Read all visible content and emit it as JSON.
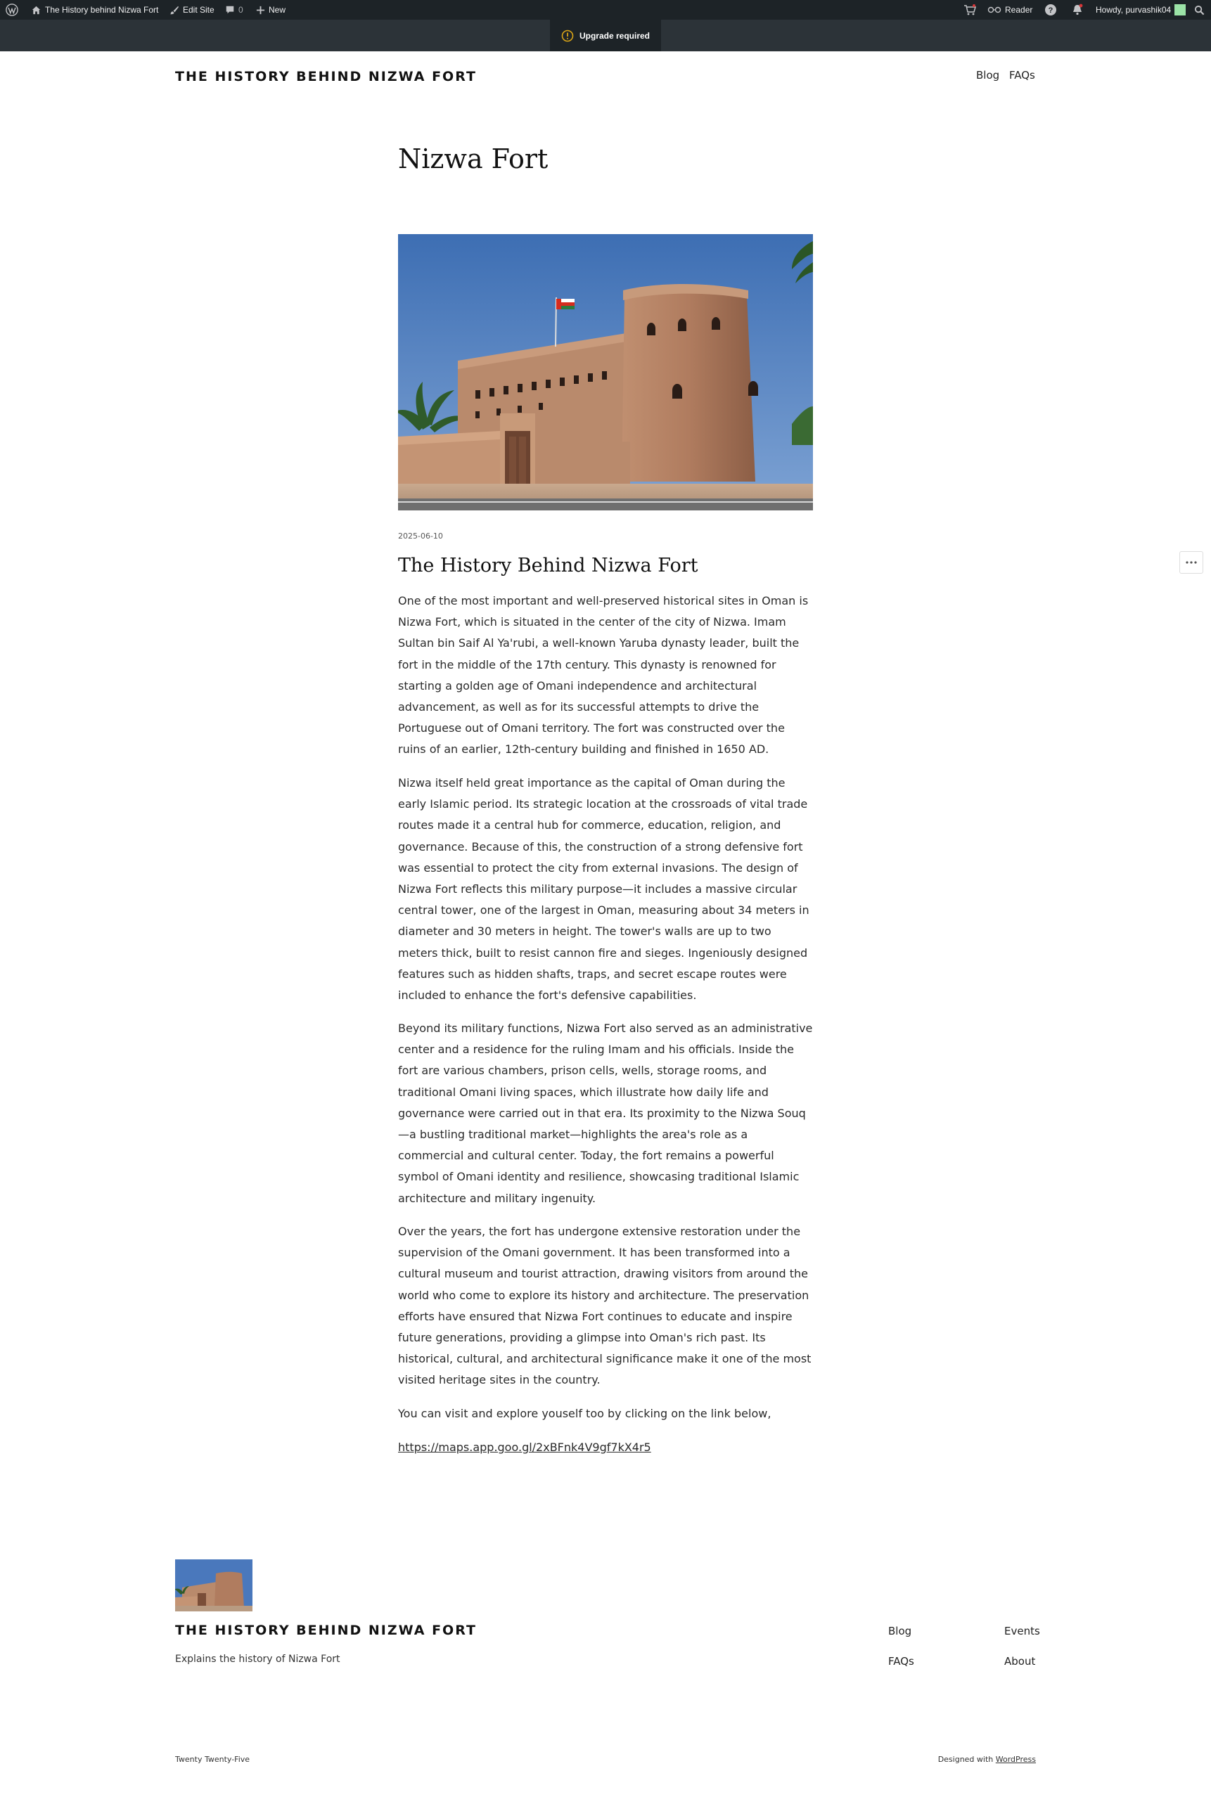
{
  "admin_bar": {
    "site_name": "The History behind Nizwa Fort",
    "edit_site": "Edit Site",
    "comments_count": "0",
    "new_label": "New",
    "reader_label": "Reader",
    "greeting": "Howdy, purvashik04"
  },
  "upgrade_notice": "Upgrade required",
  "header": {
    "site_title": "THE HISTORY BEHIND NIZWA FORT",
    "nav": [
      "Blog",
      "FAQs"
    ]
  },
  "post": {
    "title": "Nizwa Fort",
    "date": "2025-06-10",
    "heading": "The History Behind Nizwa Fort",
    "paragraphs": [
      "One of the most important and well-preserved historical sites in Oman is Nizwa Fort, which is situated in the center of the city of Nizwa. Imam Sultan bin Saif Al Ya'rubi, a well-known Yaruba dynasty leader, built the fort in the middle of the 17th century. This dynasty is renowned for starting a golden age of Omani independence and architectural advancement, as well as for its successful attempts to drive the Portuguese out of Omani territory. The fort was constructed over the ruins of an earlier, 12th-century building and finished in 1650 AD.",
      "Nizwa itself held great importance as the capital of Oman during the early Islamic period. Its strategic location at the crossroads of vital trade routes made it a central hub for commerce, education, religion, and governance. Because of this, the construction of a strong defensive fort was essential to protect the city from external invasions. The design of Nizwa Fort reflects this military purpose—it includes a massive circular central tower, one of the largest in Oman, measuring about 34 meters in diameter and 30 meters in height. The tower's walls are up to two meters thick, built to resist cannon fire and sieges. Ingeniously designed features such as hidden shafts, traps, and secret escape routes were included to enhance the fort's defensive capabilities.",
      "Beyond its military functions, Nizwa Fort also served as an administrative center and a residence for the ruling Imam and his officials. Inside the fort are various chambers, prison cells, wells, storage rooms, and traditional Omani living spaces, which illustrate how daily life and governance were carried out in that era. Its proximity to the Nizwa Souq—a bustling traditional market—highlights the area's role as a commercial and cultural center. Today, the fort remains a powerful symbol of Omani identity and resilience, showcasing traditional Islamic architecture and military ingenuity.",
      "Over the years, the fort has undergone extensive restoration under the supervision of the Omani government. It has been transformed into a cultural museum and tourist attraction, drawing visitors from around the world who come to explore its history and architecture. The preservation efforts have ensured that Nizwa Fort continues to educate and inspire future generations, providing a glimpse into Oman's rich past. Its historical, cultural, and architectural significance make it one of the most visited heritage sites in the country.",
      "You can visit and explore youself too by clicking on the link below,"
    ],
    "link": "https://maps.app.goo.gl/2xBFnk4V9gf7kX4r5"
  },
  "footer": {
    "site_title": "THE HISTORY BEHIND NIZWA FORT",
    "tagline": "Explains the history of Nizwa Fort",
    "nav": [
      "Blog",
      "Events",
      "FAQs",
      "About"
    ],
    "theme_credit": "Twenty Twenty-Five",
    "designed_with": "Designed with",
    "designed_link": "WordPress"
  },
  "colors": {
    "admin_bar": "#1d2327",
    "upgrade_icon": "#dba617",
    "avatar": "#9be3a7"
  }
}
